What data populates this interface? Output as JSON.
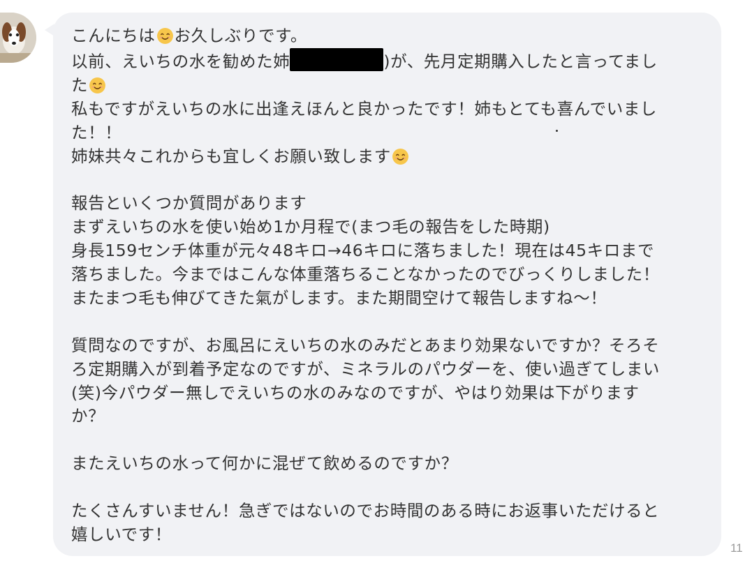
{
  "conversation": {
    "avatar_icon": "dog-photo-avatar",
    "emoji_name": "smiling-face-emoji",
    "redaction": "black-redaction-bar",
    "lines": [
      {
        "parts": [
          "こんにちは",
          "[emoji]",
          "お久しぶりです。"
        ]
      },
      {
        "parts": [
          "以前、えいちの水を勧めた姉",
          "[redacted]",
          ")が、先月定期購入したと言ってまし"
        ]
      },
      {
        "parts": [
          "た",
          "[emoji]"
        ]
      },
      {
        "parts": [
          "私もですがえいちの水に出逢えほんと良かったです！姉もとても喜んでいまし"
        ]
      },
      {
        "parts": [
          "た！！"
        ]
      },
      {
        "parts": [
          "姉妹共々これからも宜しくお願い致します",
          "[emoji]"
        ]
      },
      {
        "parts": [
          ""
        ]
      },
      {
        "parts": [
          "報告といくつか質問があります"
        ]
      },
      {
        "parts": [
          "まずえいちの水を使い始め1か月程で(まつ毛の報告をした時期)"
        ]
      },
      {
        "parts": [
          "身長159センチ体重が元々48キロ→46キロに落ちました！現在は45キロまで"
        ]
      },
      {
        "parts": [
          "落ちました。今まではこんな体重落ちることなかったのでびっくりしました！"
        ]
      },
      {
        "parts": [
          "またまつ毛も伸びてきた氣がします。また期間空けて報告しますね〜！"
        ]
      },
      {
        "parts": [
          ""
        ]
      },
      {
        "parts": [
          "質問なのですが、お風呂にえいちの水のみだとあまり効果ないですか？そろそ"
        ]
      },
      {
        "parts": [
          "ろ定期購入が到着予定なのですが、ミネラルのパウダーを、使い過ぎてしまい"
        ]
      },
      {
        "parts": [
          "(笑)今パウダー無しでえいちの水のみなのですが、やはり効果は下がります"
        ]
      },
      {
        "parts": [
          "か？"
        ]
      },
      {
        "parts": [
          ""
        ]
      },
      {
        "parts": [
          "またえいちの水って何かに混ぜて飲めるのですか？"
        ]
      },
      {
        "parts": [
          ""
        ]
      },
      {
        "parts": [
          "たくさんすいません！急ぎではないのでお時間のある時にお返事いただけると"
        ]
      },
      {
        "parts": [
          "嬉しいです！"
        ]
      }
    ],
    "timestamp": "11",
    "colors": {
      "bubble": "#f1f2f5",
      "text": "#333333",
      "timestamp": "#9a9a9a",
      "emoji_face": "#f7c64b"
    }
  }
}
